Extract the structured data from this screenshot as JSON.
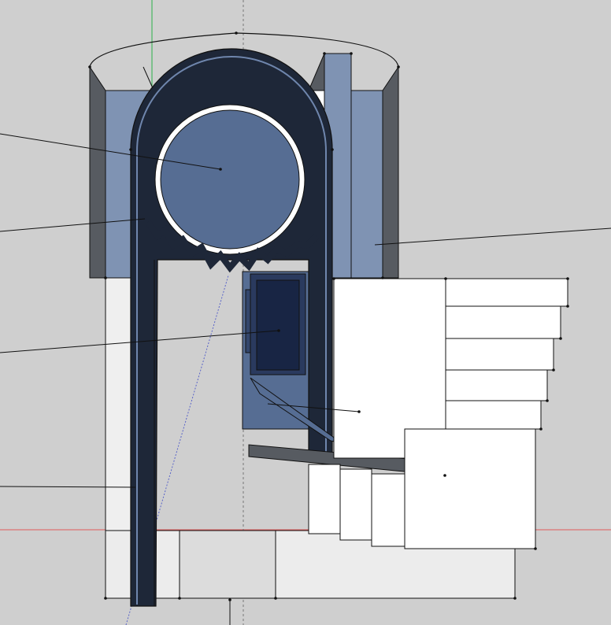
{
  "app": {
    "type": "3d-modeling-viewport",
    "visible_text": []
  },
  "scene": {
    "description_hidden": true,
    "colors": {
      "background": "#cfcfcf",
      "model_blue": "#7f93b3",
      "model_blue_mid": "#566d93",
      "model_blue_dark": "#1e2738",
      "model_navy": "#182544",
      "edge_black": "#111111",
      "face_white": "#ffffff",
      "face_light": "#ececec",
      "face_gray": "#575b61",
      "axis_green": "#2bb24a",
      "axis_red": "#e05a5a",
      "axis_blue": "#5a64c8",
      "axis_dotted": "#777777"
    },
    "icons": {
      "axis_green": "axis-green-line",
      "axis_red": "axis-red-line",
      "axis_blue": "axis-blue-line",
      "inference_guide": "dotted-guide-line"
    }
  }
}
